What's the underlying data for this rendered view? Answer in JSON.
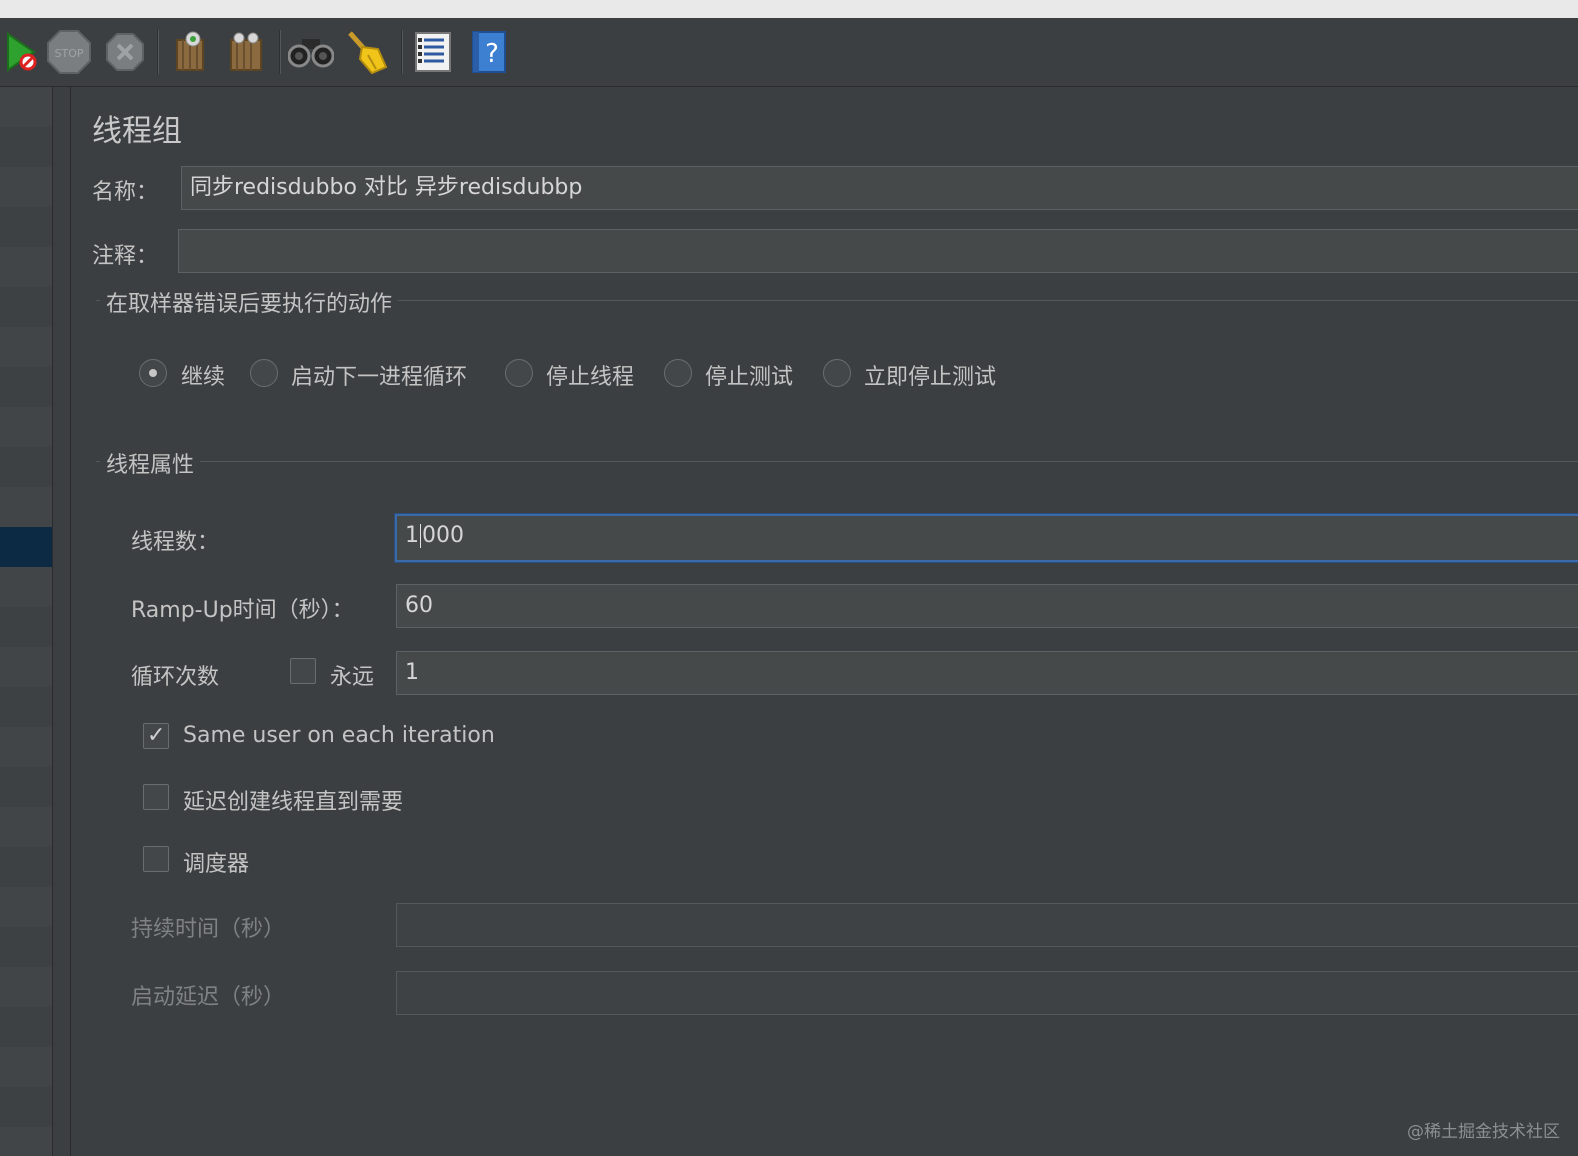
{
  "title_bar": {
    "text": ""
  },
  "toolbar": {
    "icons": [
      "start-no-pause-icon",
      "stop-icon",
      "shutdown-icon",
      "clear-icon",
      "clear-all-icon",
      "search-icon",
      "reset-search-icon",
      "function-helper-icon",
      "help-icon"
    ],
    "stop_label": "STOP"
  },
  "panel": {
    "title": "线程组",
    "name_label": "名称：",
    "name_value": "同步redisdubbo 对比 异步redisdubbp",
    "comment_label": "注释：",
    "comment_value": ""
  },
  "error_action": {
    "group_title": "在取样器错误后要执行的动作",
    "options": [
      "继续",
      "启动下一进程循环",
      "停止线程",
      "停止测试",
      "立即停止测试"
    ],
    "selected": "继续"
  },
  "thread_props": {
    "group_title": "线程属性",
    "threads_label": "线程数：",
    "threads_value_a": "1",
    "threads_value_b": "000",
    "rampup_label": "Ramp-Up时间（秒）：",
    "rampup_value": "60",
    "loop_label": "循环次数",
    "forever_label": "永远",
    "forever_checked": false,
    "loop_value": "1",
    "same_user_label": "Same user on each iteration",
    "same_user_checked": true,
    "delay_label": "延迟创建线程直到需要",
    "delay_checked": false,
    "scheduler_label": "调度器",
    "scheduler_checked": false,
    "duration_label": "持续时间（秒）",
    "duration_value": "",
    "startup_delay_label": "启动延迟（秒）",
    "startup_delay_value": ""
  },
  "watermark": "@稀土掘金技术社区",
  "colors": {
    "background": "#3c3f41",
    "field": "#45494a",
    "focus_border": "#3a6aa8",
    "selection": "#0d2a44"
  }
}
